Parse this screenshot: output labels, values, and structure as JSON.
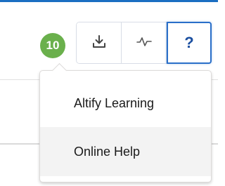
{
  "header": {
    "notification_count": "10",
    "help_label": "?",
    "buttons": [
      {
        "icon": "download-icon"
      },
      {
        "icon": "activity-icon"
      },
      {
        "icon": "help-icon"
      }
    ]
  },
  "menu": {
    "items": [
      {
        "label": "Altify Learning"
      },
      {
        "label": "Online Help",
        "hovered": true
      }
    ]
  },
  "colors": {
    "accent": "#1b6ec2",
    "badge": "#6ab04c",
    "help_border": "#2a6fc9",
    "hover_bg": "#f3f3f3"
  }
}
